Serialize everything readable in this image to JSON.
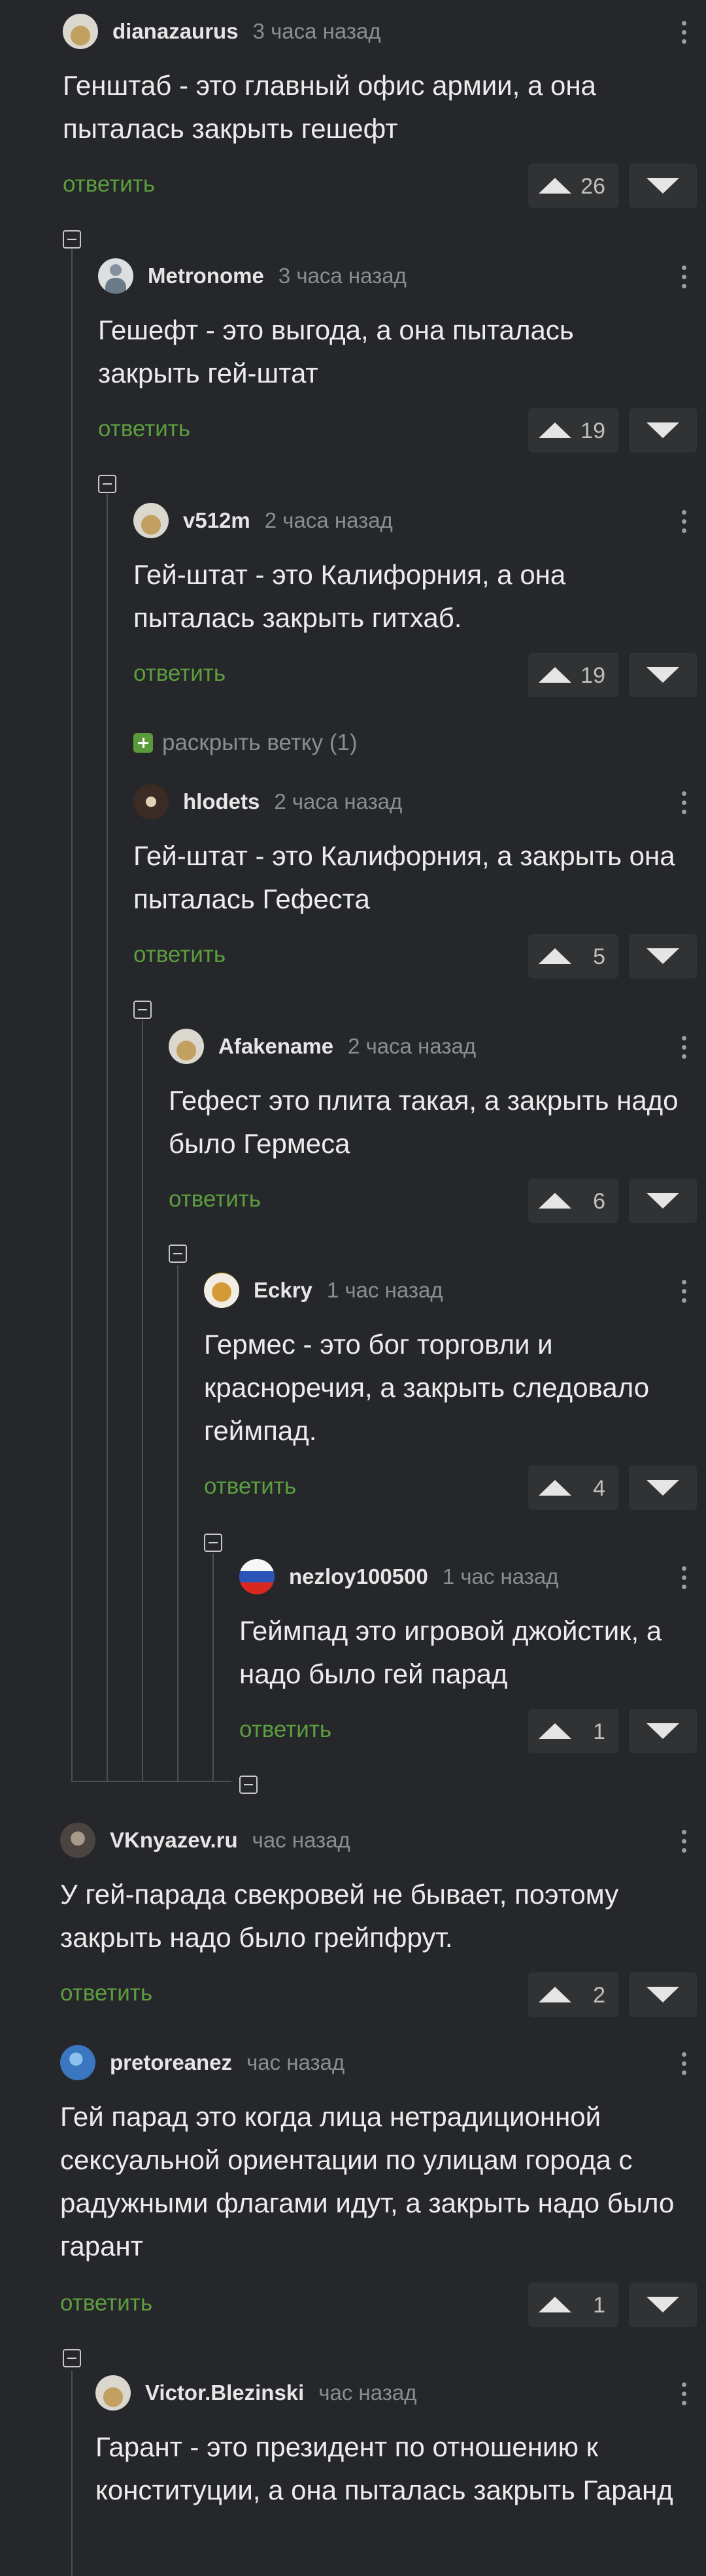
{
  "comments": [
    {
      "author": "dianazaurus",
      "time": "3 часа назад",
      "text": "Генштаб - это главный офис армии, а она пыталась закрыть гешефт",
      "reply": "ответить",
      "votes": "26",
      "avatar": "avatar-gold"
    },
    {
      "author": "Metronome",
      "time": "3 часа назад",
      "text": "Гешефт - это выгода, а она пыталась закрыть гей-штат",
      "reply": "ответить",
      "votes": "19",
      "avatar": "avatar-person"
    },
    {
      "author": "v512m",
      "time": "2 часа назад",
      "text": "Гей-штат - это Калифорния, а она пыталась закрыть гитхаб.",
      "reply": "ответить",
      "votes": "19",
      "avatar": "avatar-gold"
    },
    {
      "author": "hlodets",
      "time": "2 часа назад",
      "text": "Гей-штат - это Калифорния, а закрыть она пыталась Гефеста",
      "reply": "ответить",
      "votes": "5",
      "avatar": "avatar-dark"
    },
    {
      "author": "Afakename",
      "time": "2 часа назад",
      "text": "Гефест это плита такая, а закрыть надо было Гермеса",
      "reply": "ответить",
      "votes": "6",
      "avatar": "avatar-gold"
    },
    {
      "author": "Eckry",
      "time": "1 час назад",
      "text": "Гермес - это бог торговли и красноречия, а закрыть следовало геймпад.",
      "reply": "ответить",
      "votes": "4",
      "avatar": "avatar-orange"
    },
    {
      "author": "nezloy100500",
      "time": "1 час назад",
      "text": "Геймпад это игровой джойстик, а надо было гей парад",
      "reply": "ответить",
      "votes": "1",
      "avatar": "avatar-flag-ru"
    },
    {
      "author": "VKnyazev.ru",
      "time": "час назад",
      "text": "У гей-парада свекровей не бывает, поэтому закрыть надо было грейпфрут.",
      "reply": "ответить",
      "votes": "2",
      "avatar": "avatar-photo"
    },
    {
      "author": "pretoreanez",
      "time": "час назад",
      "text": "Гей парад это когда лица нетрадиционной сексуальной ориентации по улицам города с радужными флагами идут, а закрыть надо было гарант",
      "reply": "ответить",
      "votes": "1",
      "avatar": "avatar-blue"
    },
    {
      "author": "Victor.Blezinski",
      "time": "час назад",
      "text": "Гарант - это президент по отношению к конституции, а она пыталась закрыть Гаранд",
      "avatar": "avatar-gold"
    }
  ],
  "expand_thread": "раскрыть ветку (1)",
  "colors": {
    "background": "#25272a",
    "reply_link": "#5d9e3f",
    "text": "#ececec",
    "muted": "#8a8d91",
    "vote_bg": "#303234"
  }
}
